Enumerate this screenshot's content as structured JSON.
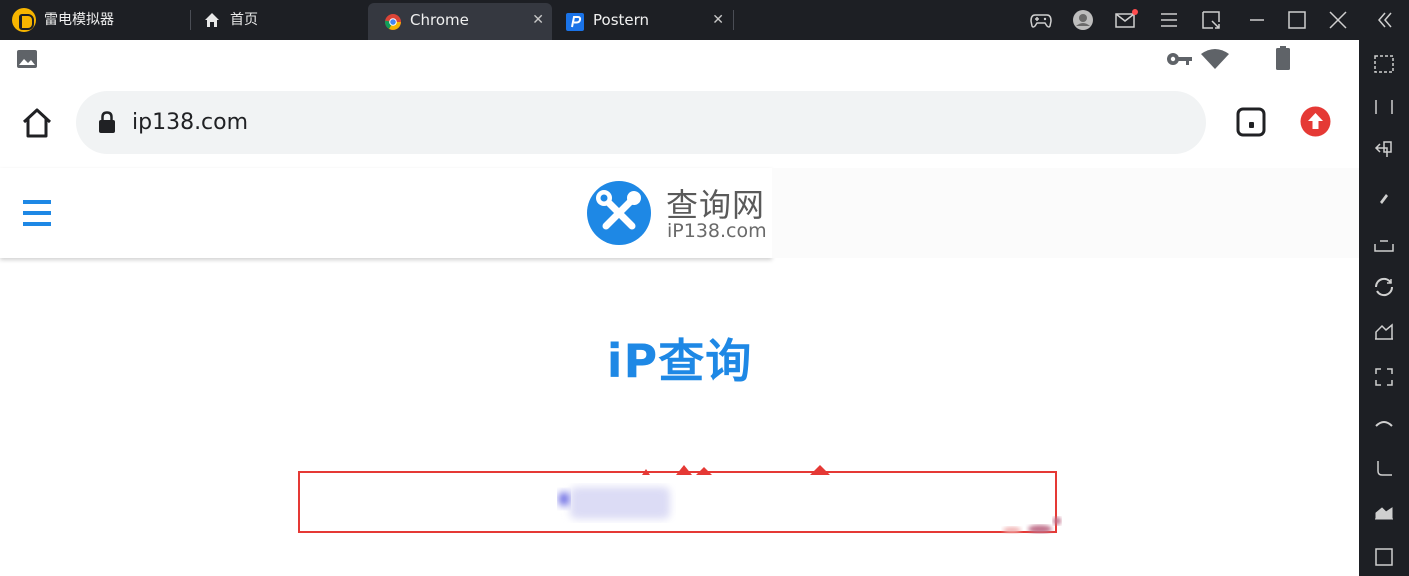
{
  "emulator": {
    "app_name": "雷电模拟器",
    "home_tab_label": "首页",
    "tabs": [
      {
        "label": "Chrome",
        "close": "✕",
        "active": true
      },
      {
        "label": "Postern",
        "close": "✕",
        "active": false
      }
    ],
    "colors": {
      "bar": "#1d1f24",
      "logo": "#f7b500",
      "active_tab": "#353840"
    }
  },
  "chrome": {
    "url": "ip138.com",
    "icons": [
      "home-icon",
      "lock-icon",
      "tab-switcher-icon",
      "update-icon"
    ],
    "update_color": "#e53935"
  },
  "site": {
    "logo_cn": "查询网",
    "logo_en": "iP138.com",
    "title": "iP查询",
    "accent": "#1e88e5",
    "box_border": "#e53935"
  }
}
